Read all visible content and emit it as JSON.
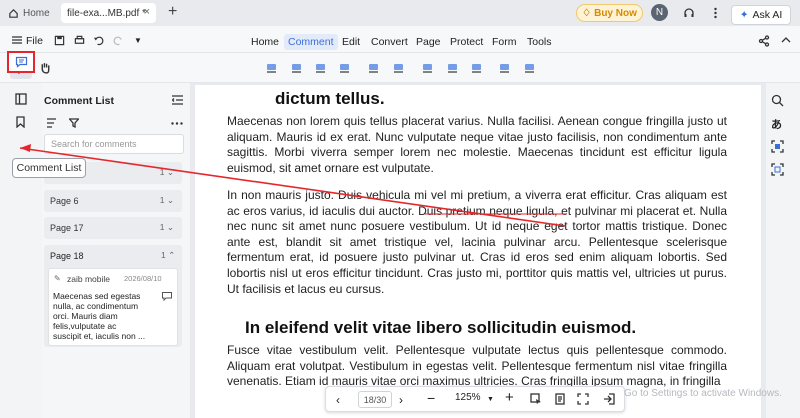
{
  "tabs": {
    "home_label": "Home",
    "file_label": "file-exa...MB.pdf *",
    "close": "×",
    "new_tab": "+"
  },
  "top_right": {
    "buy_now": "Buy Now",
    "avatar_initial": "N",
    "minimize": "—",
    "maximize": "☐",
    "close": "✕"
  },
  "menubar": {
    "file": "File",
    "items": [
      "Home",
      "Comment",
      "Edit",
      "Convert",
      "Page",
      "Protect",
      "Form",
      "Tools"
    ],
    "active": "Comment"
  },
  "toolbar": {
    "ask_ai": "Ask AI"
  },
  "comment_panel": {
    "title": "Comment List",
    "search_placeholder": "Search for comments",
    "tooltip": "Comment List",
    "groups": [
      {
        "label": "",
        "count": "1"
      },
      {
        "label": "Page 6",
        "count": "1"
      },
      {
        "label": "Page 17",
        "count": "1"
      },
      {
        "label": "Page 18",
        "count": "1"
      }
    ],
    "card": {
      "author": "zaib mobile",
      "date": "2026/08/10",
      "text_lines": [
        "Maecenas sed egestas",
        "nulla, ac condimentum",
        "orci. Mauris diam",
        "felis,vulputate ac",
        "suscipit et, iaculis non ..."
      ]
    }
  },
  "document": {
    "heading_top": "dictum tellus.",
    "para1": "Maecenas non lorem quis tellus placerat varius. Nulla facilisi. Aenean congue fringilla justo ut aliquam. Mauris id ex erat. Nunc vulputate neque vitae justo facilisis, non condimentum ante sagittis. Morbi viverra semper lorem nec molestie. Maecenas tincidunt est efficitur ligula euismod, sit amet ornare est vulputate.",
    "para2": "In non mauris justo. Duis vehicula mi vel mi pretium, a viverra erat efficitur. Cras aliquam est ac eros varius, id iaculis dui auctor. Duis pretium neque ligula, et pulvinar mi placerat et. Nulla nec nunc sit amet nunc posuere vestibulum. Ut id neque eget tortor mattis tristique. Donec ante est, blandit sit amet tristique vel, lacinia pulvinar arcu. Pellentesque scelerisque fermentum erat, id posuere justo pulvinar ut. Cras id eros sed enim aliquam lobortis. Sed lobortis nisl ut eros efficitur tincidunt. Cras justo mi, porttitor quis mattis vel, ultricies ut purus. Ut facilisis et lacus eu cursus.",
    "heading_mid": "In eleifend velit vitae libero sollicitudin euismod.",
    "para3": "Fusce vitae vestibulum velit. Pellentesque vulputate lectus quis pellentesque commodo. Aliquam erat volutpat. Vestibulum in egestas velit. Pellentesque fermentum nisl vitae fringilla venenatis. Etiam id mauris vitae orci maximus ultricies. Cras fringilla ipsum magna, in fringilla"
  },
  "bottom_nav": {
    "page_indicator": "18/30",
    "zoom": "125%",
    "watermark": "Go to Settings to activate Windows."
  },
  "colors": {
    "accent": "#3b6fd6",
    "highlight_red": "#e5272d",
    "buy_now": "#d88a00"
  }
}
